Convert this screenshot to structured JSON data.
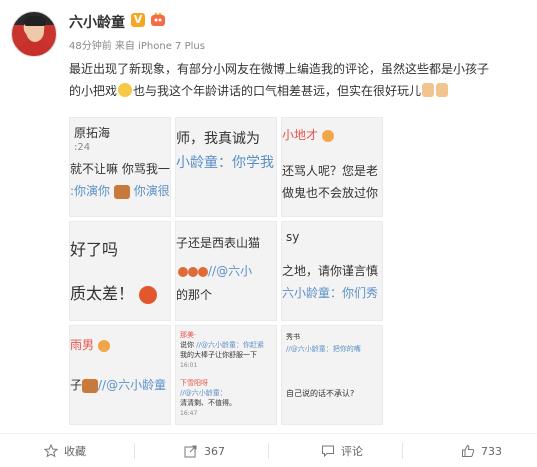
{
  "user": {
    "name": "六小龄童",
    "verified_icon": "verified-v-icon",
    "level_icon": "member-level-icon"
  },
  "meta": {
    "time": "48分钟前",
    "source": "来自 iPhone 7 Plus"
  },
  "content": {
    "line1": "最近出现了新现象，有部分小网友在微博上编造我的评论，虽然这些都是小孩子",
    "line2a": "的小把戏",
    "line2b": "也与我这个年龄讲话的口气相差甚远，但实在很好玩儿"
  },
  "grid": {
    "c1": {
      "a": "原拓海",
      "b": ":24",
      "c": "就不让嘛 你骂我一",
      "d": ":你演你",
      "e": "你演很"
    },
    "c2": {
      "a": "师，我真诚为",
      "b": "小龄童：你学我"
    },
    "c3": {
      "a": "小地才",
      "b": "还骂人呢？您是老",
      "c": "做鬼也不会放过你"
    },
    "c4": {
      "a": "好了吗",
      "b": "质太差！"
    },
    "c5": {
      "a": "子还是西表山猫",
      "b": "//@六小",
      "c": "的那个"
    },
    "c6": {
      "a": "sy",
      "b": "之地，请你谨言慎",
      "c": "六小龄童：你们秀"
    },
    "c7": {
      "a": "雨男",
      "b": "子",
      "c": "//@六小龄童"
    },
    "c8": {
      "a": "那美·",
      "b": "说你",
      "c": "//@六小龄童：你赶紧",
      "d": "我的大棒子让你舒服一下",
      "e": "16:01",
      "f": "下雪阳呀",
      "g": "//@六小龄童：",
      "h": "清清剩、不值得。",
      "i": "16:47"
    },
    "c9": {
      "a": "秀书",
      "b": "//@六小龄童：把你的嘴",
      "c": "自己说的话不承认?"
    }
  },
  "actions": {
    "favorite": "收藏",
    "repost_count": "367",
    "comment": "评论",
    "like_count": "733"
  },
  "colors": {
    "link_blue": "#5b8fc8",
    "verified_orange": "#f5a623",
    "text": "#333333",
    "meta_gray": "#888888"
  }
}
